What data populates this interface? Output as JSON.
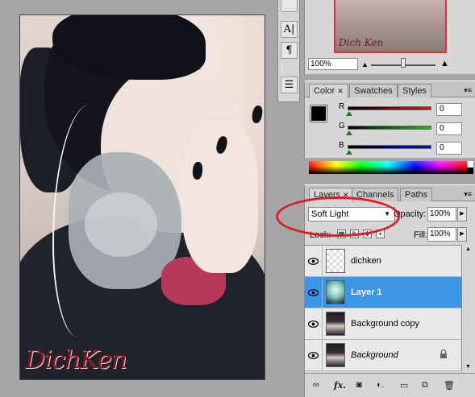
{
  "document": {
    "watermark": "DichKen"
  },
  "tool_strip": {
    "tools": [
      {
        "icon": "character-icon",
        "glyph": "A|"
      },
      {
        "icon": "paragraph-icon",
        "glyph": "¶"
      },
      {
        "icon": "notes-icon",
        "glyph": "☰"
      }
    ]
  },
  "navigator": {
    "thumb_watermark": "Dich Ken",
    "zoom": "100%",
    "zoom_slider_level_percent": 50
  },
  "color_panel": {
    "tabs": [
      {
        "label": "Color",
        "active": true,
        "closable": true
      },
      {
        "label": "Swatches",
        "active": false,
        "closable": false
      },
      {
        "label": "Styles",
        "active": false,
        "closable": false
      }
    ],
    "channels": [
      {
        "label": "R",
        "value": "0",
        "color": "#cc1111"
      },
      {
        "label": "G",
        "value": "0",
        "color": "#11aa11"
      },
      {
        "label": "B",
        "value": "0",
        "color": "#1111cc"
      }
    ],
    "foreground_color": "#000000",
    "background_color": "#ffffff"
  },
  "layers_panel": {
    "tabs": [
      {
        "label": "Layers",
        "active": true,
        "closable": true
      },
      {
        "label": "Channels",
        "active": false,
        "closable": false
      },
      {
        "label": "Paths",
        "active": false,
        "closable": false
      }
    ],
    "blend_mode": "Soft Light",
    "opacity_label": "Opacity:",
    "opacity_value": "100%",
    "lock_label": "Lock:",
    "fill_label": "Fill:",
    "fill_value": "100%",
    "layers": [
      {
        "name": "dichken",
        "selected": false,
        "visible": true,
        "locked": false,
        "thumb": "transparent"
      },
      {
        "name": "Layer 1",
        "selected": true,
        "visible": true,
        "locked": false,
        "thumb": "teal-gradient"
      },
      {
        "name": "Background copy",
        "selected": false,
        "visible": true,
        "locked": false,
        "thumb": "photo"
      },
      {
        "name": "Background",
        "selected": false,
        "visible": true,
        "locked": true,
        "thumb": "photo"
      }
    ],
    "bottom_icons": [
      "link-icon",
      "fx-icon",
      "mask-icon",
      "adjustment-icon",
      "group-folder-icon",
      "new-layer-icon",
      "trash-icon"
    ]
  },
  "annotation": {
    "color": "#e11d24"
  }
}
